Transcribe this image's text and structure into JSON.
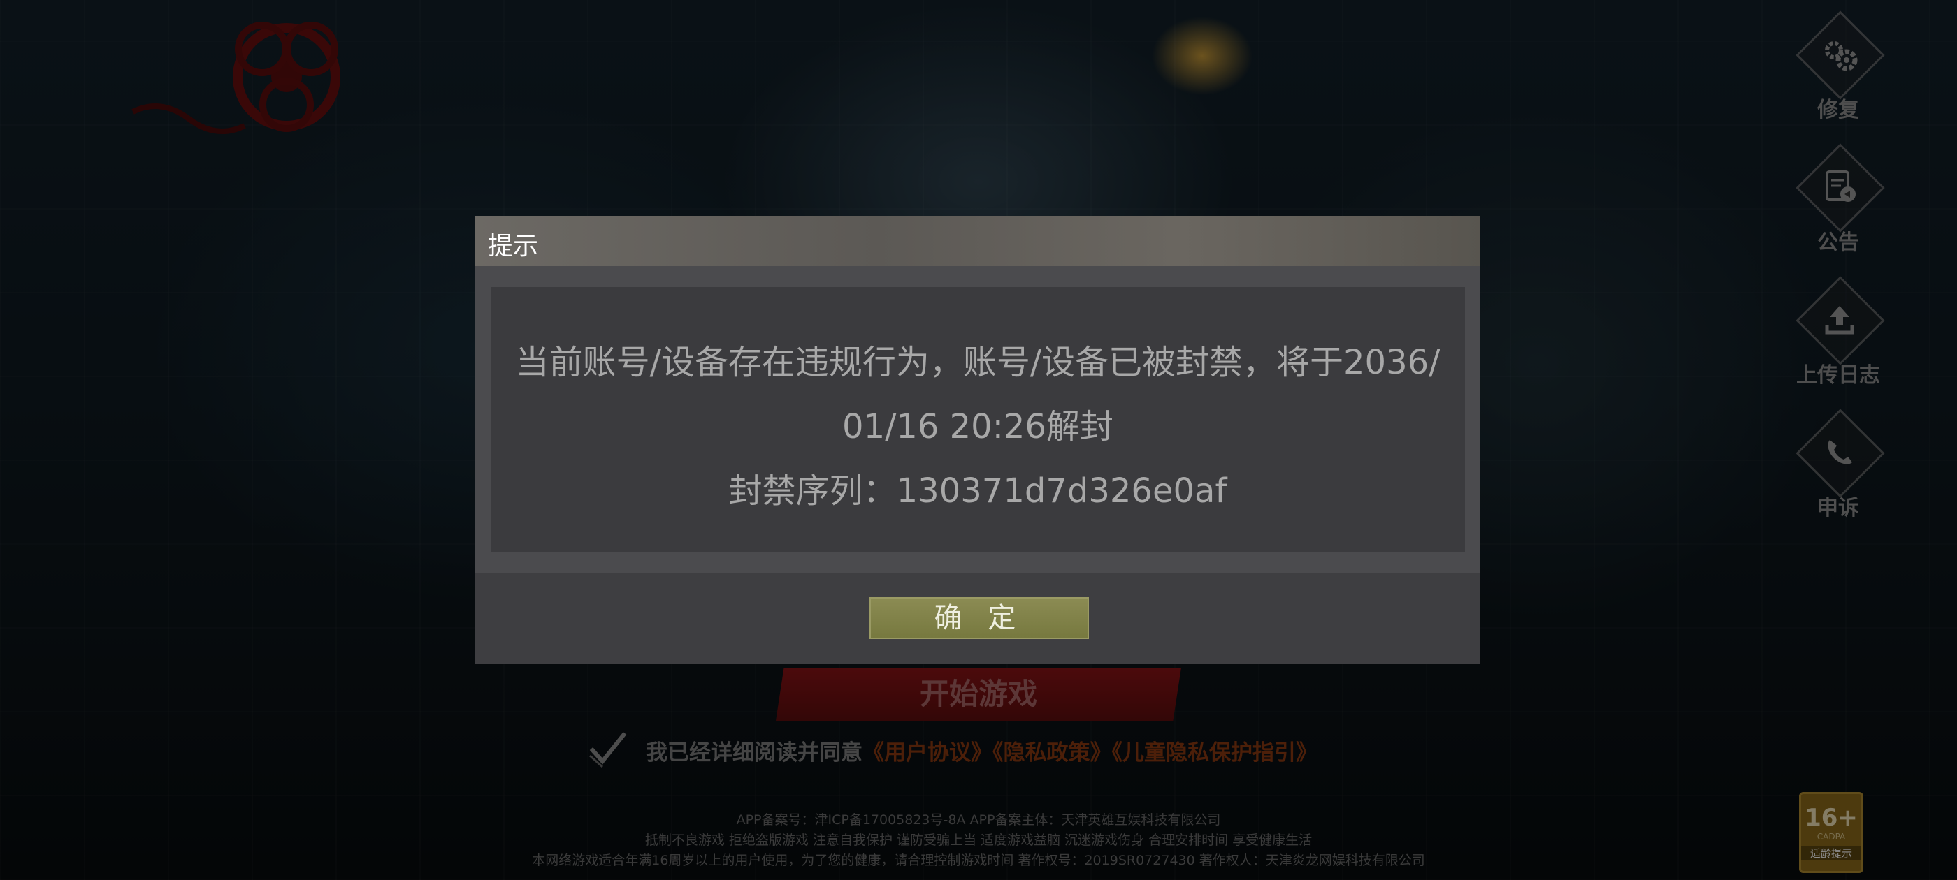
{
  "side_menu": [
    {
      "name": "repair",
      "label": "修复",
      "icon": "gears-icon"
    },
    {
      "name": "notice",
      "label": "公告",
      "icon": "announcement-icon"
    },
    {
      "name": "upload-log",
      "label": "上传日志",
      "icon": "upload-icon"
    },
    {
      "name": "appeal",
      "label": "申诉",
      "icon": "phone-icon"
    }
  ],
  "start_button": "开始游戏",
  "agreement": {
    "prefix": "我已经详细阅读并同意",
    "user_agreement": "《用户协议》",
    "privacy_policy": "《隐私政策》",
    "child_privacy": "《儿童隐私保护指引》"
  },
  "footer": {
    "line1": "APP备案号：津ICP备17005823号-8A   APP备案主体：天津英雄互娱科技有限公司",
    "line2": "抵制不良游戏 拒绝盗版游戏 注意自我保护 谨防受骗上当 适度游戏益脑 沉迷游戏伤身 合理安排时间 享受健康生活",
    "line3": "本网络游戏适合年满16周岁以上的用户使用，为了您的健康，请合理控制游戏时间   著作权号：2019SR0727430   著作权人：天津炎龙网娱科技有限公司"
  },
  "age_rating": {
    "big": "16+",
    "org": "CADPA",
    "label": "适龄提示"
  },
  "dialog": {
    "title": "提示",
    "message_line1": "当前账号/设备存在违规行为，账号/设备已被封禁，将于2036/",
    "message_line2": "01/16 20:26解封",
    "ban_serial": "封禁序列：130371d7d326e0af",
    "confirm": "确 定"
  },
  "colors": {
    "dialog_header": "#5f5c57",
    "dialog_body": "#3e3e41",
    "confirm_button": "#7f8046",
    "start_button": "#7a1213",
    "link": "#8b3a12"
  }
}
